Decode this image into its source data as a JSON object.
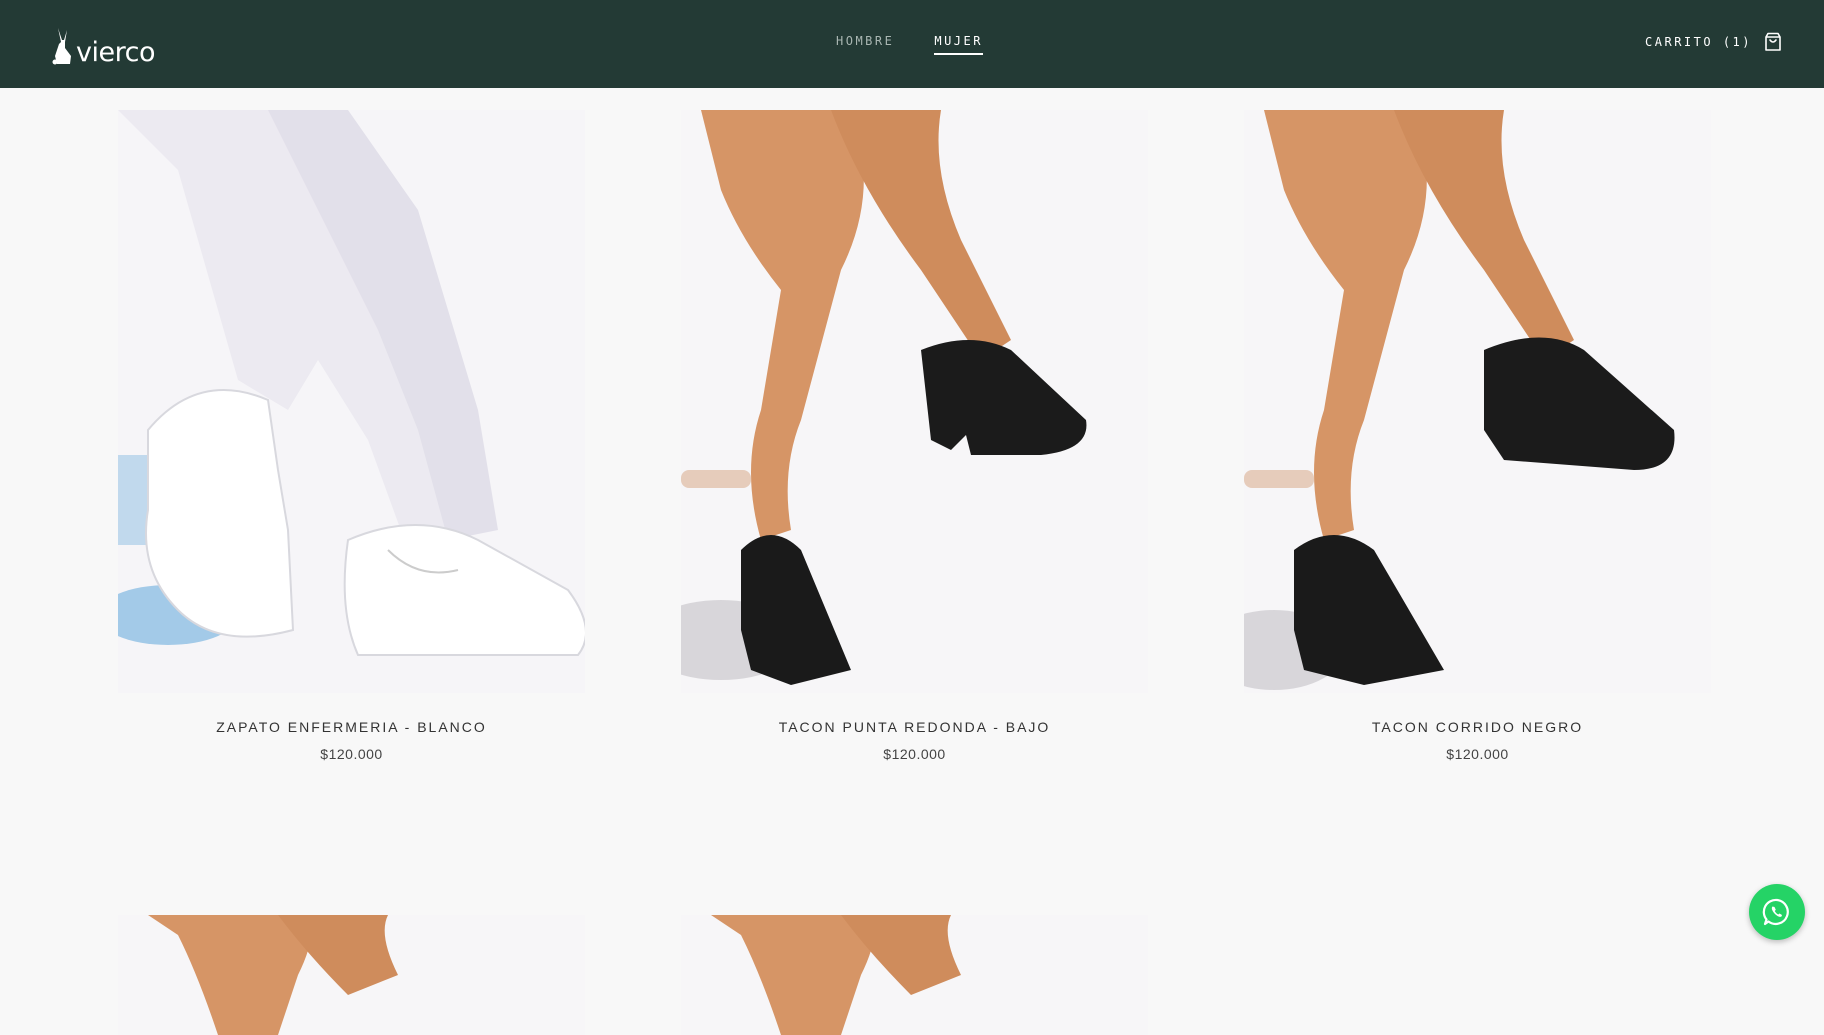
{
  "brand": {
    "name": "vierco",
    "header_bg": "#233a35",
    "whatsapp_color": "#25d366"
  },
  "nav": {
    "items": [
      {
        "label": "HOMBRE",
        "active": false
      },
      {
        "label": "MUJER",
        "active": true
      }
    ]
  },
  "cart": {
    "label": "CARRITO (1)",
    "icon": "shopping-bag-icon"
  },
  "products": [
    {
      "title": "ZAPATO ENFERMERIA - BLANCO",
      "price": "$120.000",
      "image": "white-nursing-shoe-photo"
    },
    {
      "title": "TACON PUNTA REDONDA - BAJO",
      "price": "$120.000",
      "image": "black-low-heel-pump-photo"
    },
    {
      "title": "TACON CORRIDO NEGRO",
      "price": "$120.000",
      "image": "black-wedge-loafer-photo"
    },
    {
      "title": "",
      "price": "",
      "image": "product-photo-4"
    },
    {
      "title": "",
      "price": "",
      "image": "product-photo-5"
    }
  ],
  "whatsapp": {
    "icon": "whatsapp-icon"
  }
}
